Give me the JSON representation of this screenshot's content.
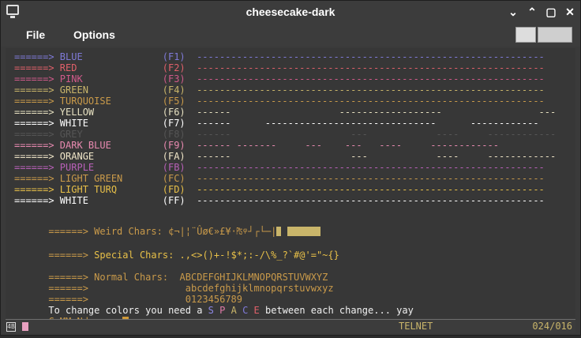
{
  "window": {
    "title": "cheesecake-dark",
    "buttons": [
      "⌄",
      "⌃",
      "▢",
      "✕"
    ]
  },
  "menu": {
    "file": "File",
    "options": "Options"
  },
  "colors": {
    "blue": "#8e88e8",
    "red": "#e8606a",
    "pink": "#e07aa8",
    "green": "#c9b56a",
    "turquoise": "#c9a04a",
    "yellow": "#c9b56a",
    "white": "#ffffff",
    "grey": "#5a5a5a",
    "dark_blue": "#e88ab0",
    "orange": "#d9c88a",
    "purple": "#c070c0",
    "light_green": "#c9a04a",
    "light_turq": "#e8c048",
    "tan": "#c9a04a"
  },
  "color_rows": [
    {
      "arrow": "======> ",
      "name": "BLUE",
      "code": "(F1)",
      "dashes": "-------------------------------------------------------------",
      "color": "#7f7ad8"
    },
    {
      "arrow": "======> ",
      "name": "RED",
      "code": "(F2)",
      "dashes": "-------------------------------------------------------------",
      "color": "#e0606a"
    },
    {
      "arrow": "======> ",
      "name": "PINK",
      "code": "(F3)",
      "dashes": "-------------------------------------------------------------",
      "color": "#d05a8a"
    },
    {
      "arrow": "======> ",
      "name": "GREEN",
      "code": "(F4)",
      "dashes": "-------------------------------------------------------------",
      "color": "#c9b56a"
    },
    {
      "arrow": "======> ",
      "name": "TURQUOISE",
      "code": "(F5)",
      "dashes": "-------------------------------------------------------------",
      "color": "#c99a4a"
    },
    {
      "arrow": "======> ",
      "name": "YELLOW",
      "code": "(F6)",
      "dashes": "------                   ------------------                 ---",
      "color": "#e6e0c0"
    },
    {
      "arrow": "======> ",
      "name": "WHITE",
      "code": "(F7)",
      "dashes": "------      ------------------------------      ------------",
      "color": "#ffffff"
    },
    {
      "arrow": "======> ",
      "name": "GREY",
      "code": "(F8)",
      "dashes": "------                     ---            ----     ------------",
      "color": "#555555"
    },
    {
      "arrow": "======> ",
      "name": "DARK BLUE",
      "code": "(F9)",
      "dashes": "------ -------     ---    ---   ----     ------------",
      "color": "#e88ab0"
    },
    {
      "arrow": "======> ",
      "name": "ORANGE",
      "code": "(FA)",
      "dashes": "------                     ---            ----     ------------",
      "color": "#f0e6c8"
    },
    {
      "arrow": "======> ",
      "name": "PURPLE",
      "code": "(FB)",
      "dashes": "-------------------------------------------------------------",
      "color": "#b860b8"
    },
    {
      "arrow": "======> ",
      "name": "LIGHT GREEN",
      "code": "(FC)",
      "dashes": "-------------------------------------------------------------",
      "color": "#c99a4a"
    },
    {
      "arrow": "======> ",
      "name": "LIGHT TURQ",
      "code": "(FD)",
      "dashes": "-------------------------------------------------------------",
      "color": "#e8c048"
    },
    {
      "arrow": "======> ",
      "name": "WHITE",
      "code": "(FF)",
      "dashes": "-------------------------------------------------------------",
      "color": "#ffffff"
    }
  ],
  "weird": {
    "arrow": "======> ",
    "label": "Weird Chars:",
    "chars": "¢¬|¦¨Ûø€»£¥·₧ᵠ┘┌└─|",
    "color": "#c99a4a"
  },
  "special": {
    "arrow": "======> ",
    "label": "Special Chars:",
    "chars": ".,<>()+-!$*;:-/\\%_?`#@'=\"~{}",
    "color": "#e8c048"
  },
  "normal": {
    "arrow": "======> ",
    "label": "Normal Chars:",
    "upper": "ABCDEFGHIJKLMNOPQRSTUVWXYZ",
    "lower": "abcdefghijklmnopqrstuvwxyz",
    "digits": "0123456789",
    "color": "#c99a4a"
  },
  "message": {
    "before": "To change colors you need a ",
    "space_letters": [
      "S",
      "P",
      "A",
      "C",
      "E"
    ],
    "space_colors": [
      "#8e88e8",
      "#e07aa8",
      "#c9b56a",
      "#7f7ad8",
      "#e0606a"
    ],
    "after": " between each change... yay"
  },
  "command": {
    "prompt": "CoMMaNd ===>"
  },
  "status": {
    "session": "TELNET",
    "position": "024/016",
    "kb_label": "4B"
  }
}
